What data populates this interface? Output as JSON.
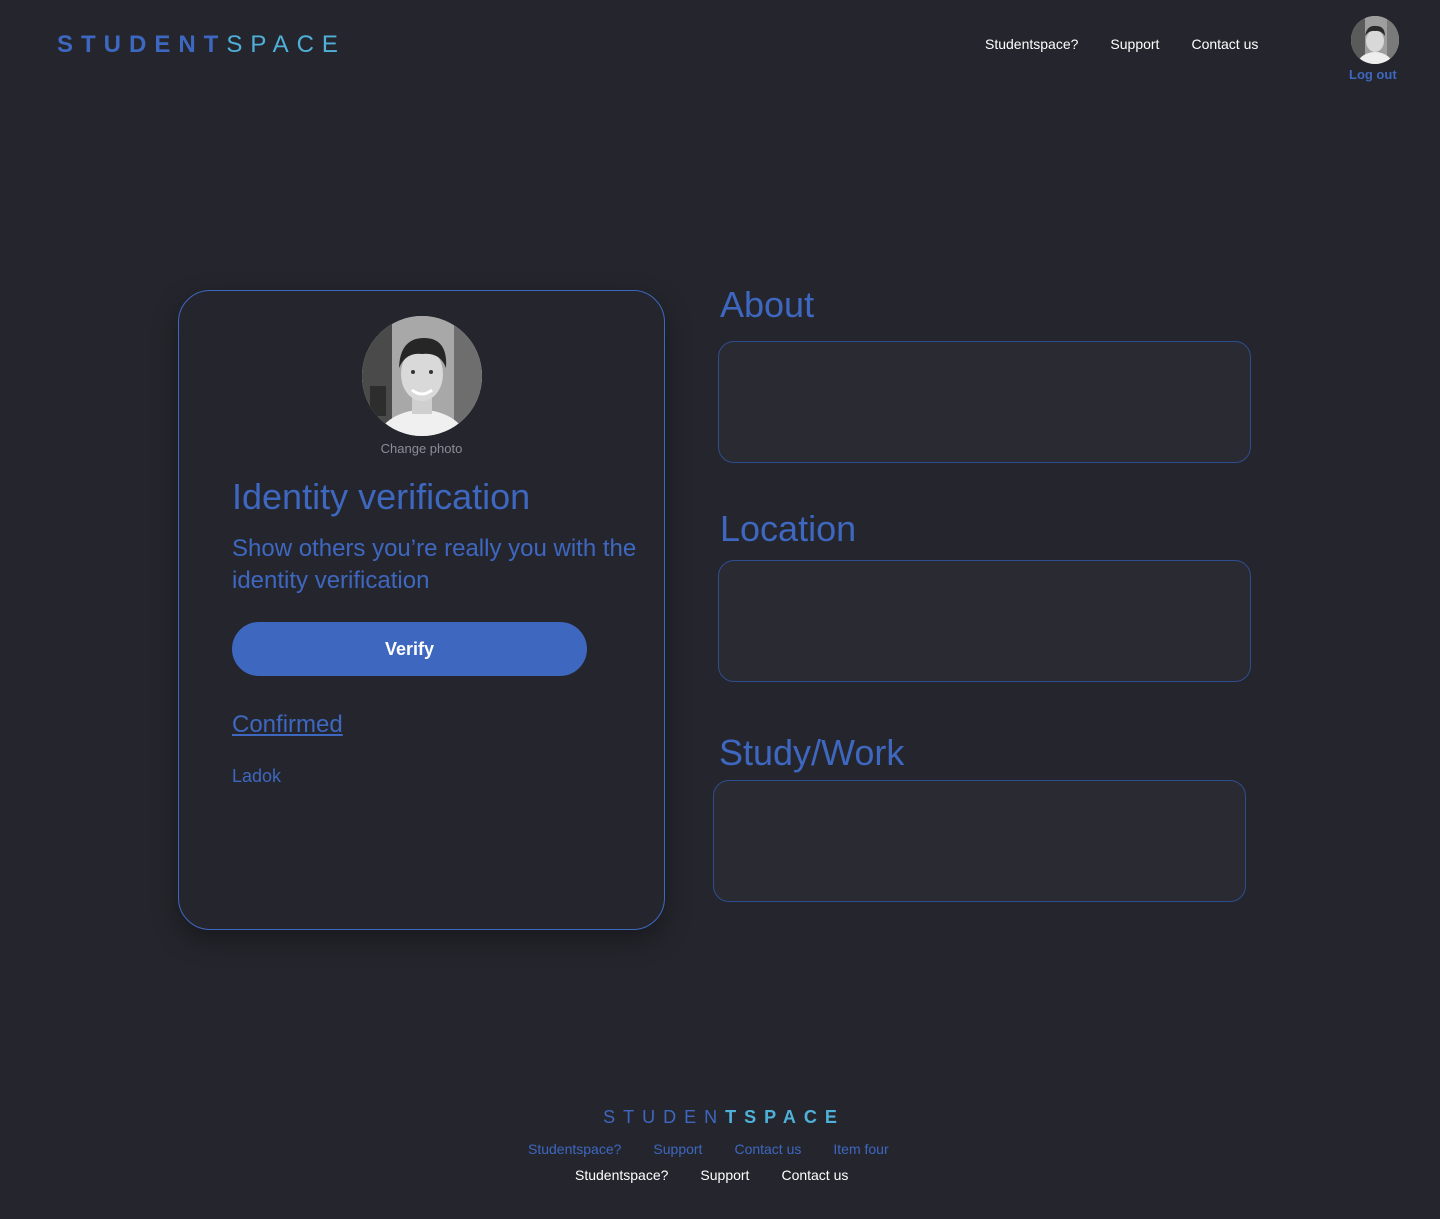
{
  "header": {
    "logo_part1": "STUDENT",
    "logo_part2": "SPACE",
    "nav": [
      "Studentspace?",
      "Support",
      "Contact us"
    ],
    "logout_label": "Log out"
  },
  "profile": {
    "change_photo_label": "Change photo",
    "title": "Identity verification",
    "subtitle": "Show others you’re really you with the identity verification",
    "verify_label": "Verify",
    "confirmed_label": "Confirmed",
    "source_label": "Ladok"
  },
  "fields": {
    "about_label": "About",
    "location_label": "Location",
    "study_label": "Study/Work"
  },
  "footer": {
    "logo_part1": "STUDEN",
    "logo_part2": "TSPACE",
    "nav_primary": [
      "Studentspace?",
      "Support",
      "Contact us",
      "Item four"
    ],
    "nav_secondary": [
      "Studentspace?",
      "Support",
      "Contact us"
    ]
  },
  "colors": {
    "background": "#25262d",
    "accent": "#3e67c0",
    "logo_light": "#4fb1d9",
    "text": "#ffffff"
  }
}
